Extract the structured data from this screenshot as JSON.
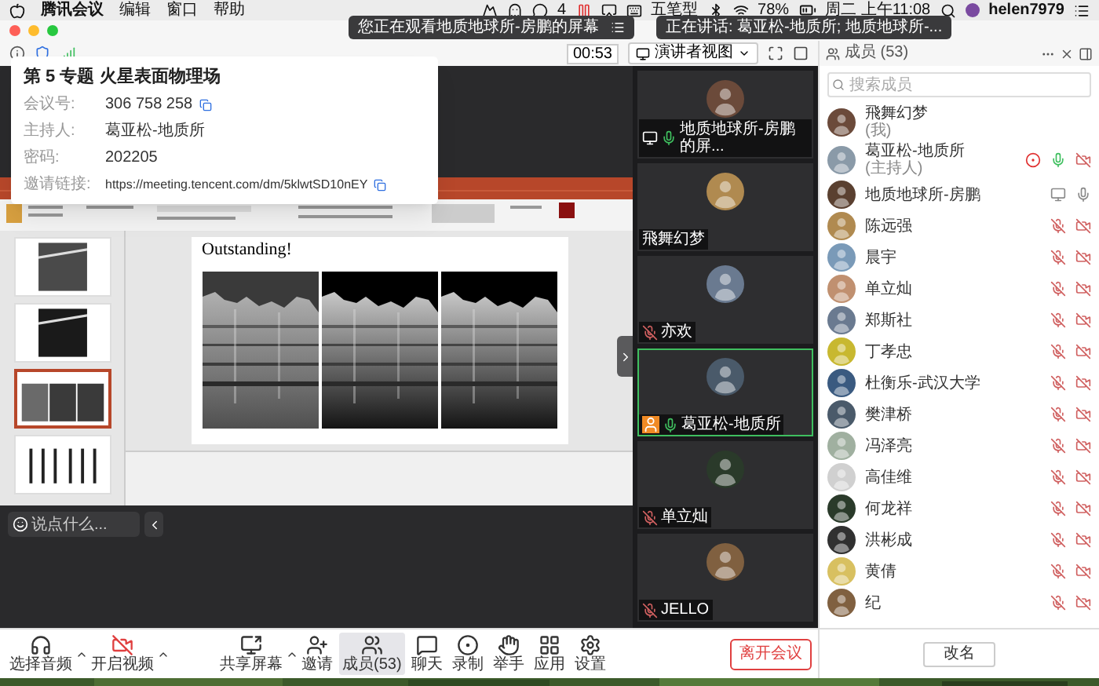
{
  "menu_bar": {
    "app_menus": [
      "腾讯会议",
      "编辑",
      "窗口",
      "帮助"
    ],
    "chat_badge": "4",
    "input_method": "五笔型",
    "battery": "78%",
    "clock": "周二 上午11:08",
    "user": "helen7979"
  },
  "window": {
    "notice": "您正在观看地质地球所-房鹏的屏幕",
    "speaking": "正在讲话: 葛亚松-地质所; 地质地球所-...",
    "timer": "00:53",
    "view_button": "演讲者视图"
  },
  "meeting_info": {
    "title": "第 5 专题 火星表面物理场",
    "rows": [
      {
        "label": "会议号:",
        "value": "306 758 258",
        "copyable": true
      },
      {
        "label": "主持人:",
        "value": "葛亚松-地质所",
        "copyable": false
      },
      {
        "label": "密码:",
        "value": "202205",
        "copyable": false
      },
      {
        "label": "邀请链接:",
        "value": "https://meeting.tencent.com/dm/5klwtSD10nEY",
        "copyable": true
      }
    ]
  },
  "presentation": {
    "slide_title": "Outstanding!",
    "thumbnails": [
      {
        "selected": false
      },
      {
        "selected": false
      },
      {
        "selected": true
      },
      {
        "selected": false
      }
    ]
  },
  "chat_input": {
    "placeholder": "说点什么..."
  },
  "videos": [
    {
      "name": "地质地球所-房鹏的屏...",
      "talking": true,
      "muted": false,
      "sharing": true,
      "host": false,
      "speaking": false
    },
    {
      "name": "飛舞幻梦",
      "talking": false,
      "muted": false,
      "sharing": false,
      "host": false,
      "speaking": false
    },
    {
      "name": "亦欢",
      "talking": false,
      "muted": true,
      "sharing": false,
      "host": false,
      "speaking": false
    },
    {
      "name": "葛亚松-地质所",
      "talking": true,
      "muted": false,
      "sharing": false,
      "host": true,
      "speaking": true
    },
    {
      "name": "单立灿",
      "talking": false,
      "muted": true,
      "sharing": false,
      "host": false,
      "speaking": false
    },
    {
      "name": "JELLO",
      "talking": false,
      "muted": true,
      "sharing": false,
      "host": false,
      "speaking": false
    }
  ],
  "members_panel": {
    "title": "成员 (53)",
    "search": {
      "placeholder": "搜索成员"
    },
    "members": [
      {
        "name": "飛舞幻梦",
        "role": "(我)",
        "recording": false,
        "sharing": false,
        "talking": false,
        "mic_on": false,
        "muted": false,
        "camera_off": false
      },
      {
        "name": "葛亚松-地质所",
        "role": "(主持人)",
        "recording": true,
        "sharing": false,
        "talking": true,
        "mic_on": false,
        "muted": false,
        "camera_off": true
      },
      {
        "name": "地质地球所-房鹏",
        "recording": false,
        "sharing": true,
        "talking": false,
        "mic_on": true,
        "muted": false,
        "camera_off": false
      },
      {
        "name": "陈远强",
        "recording": false,
        "sharing": false,
        "talking": false,
        "mic_on": false,
        "muted": true,
        "camera_off": true
      },
      {
        "name": "晨宇",
        "recording": false,
        "sharing": false,
        "talking": false,
        "mic_on": false,
        "muted": true,
        "camera_off": true
      },
      {
        "name": "单立灿",
        "recording": false,
        "sharing": false,
        "talking": false,
        "mic_on": false,
        "muted": true,
        "camera_off": true
      },
      {
        "name": "郑斯社",
        "recording": false,
        "sharing": false,
        "talking": false,
        "mic_on": false,
        "muted": true,
        "camera_off": true
      },
      {
        "name": "丁孝忠",
        "recording": false,
        "sharing": false,
        "talking": false,
        "mic_on": false,
        "muted": true,
        "camera_off": true
      },
      {
        "name": "杜衡乐-武汉大学",
        "recording": false,
        "sharing": false,
        "talking": false,
        "mic_on": false,
        "muted": true,
        "camera_off": true
      },
      {
        "name": "樊津桥",
        "recording": false,
        "sharing": false,
        "talking": false,
        "mic_on": false,
        "muted": true,
        "camera_off": true
      },
      {
        "name": "冯泽亮",
        "recording": false,
        "sharing": false,
        "talking": false,
        "mic_on": false,
        "muted": true,
        "camera_off": true
      },
      {
        "name": "高佳维",
        "recording": false,
        "sharing": false,
        "talking": false,
        "mic_on": false,
        "muted": true,
        "camera_off": true
      },
      {
        "name": "何龙祥",
        "recording": false,
        "sharing": false,
        "talking": false,
        "mic_on": false,
        "muted": true,
        "camera_off": true
      },
      {
        "name": "洪彬成",
        "recording": false,
        "sharing": false,
        "talking": false,
        "mic_on": false,
        "muted": true,
        "camera_off": true
      },
      {
        "name": "黄倩",
        "recording": false,
        "sharing": false,
        "talking": false,
        "mic_on": false,
        "muted": true,
        "camera_off": true
      },
      {
        "name": "纪",
        "recording": false,
        "sharing": false,
        "talking": false,
        "mic_on": false,
        "muted": true,
        "camera_off": true
      }
    ],
    "rename_button": "改名"
  },
  "toolbar": {
    "items": [
      {
        "label": "选择音频",
        "kind": "audio",
        "menu": true,
        "selected": false
      },
      {
        "label": "开启视频",
        "kind": "video",
        "menu": true,
        "selected": false
      },
      {
        "label": "共享屏幕",
        "kind": "share",
        "menu": true,
        "selected": false
      },
      {
        "label": "邀请",
        "kind": "invite",
        "menu": false,
        "selected": false
      },
      {
        "label": "成员(53)",
        "kind": "members",
        "menu": false,
        "selected": true
      },
      {
        "label": "聊天",
        "kind": "chat",
        "menu": false,
        "selected": false
      },
      {
        "label": "录制",
        "kind": "record",
        "menu": false,
        "selected": false
      },
      {
        "label": "举手",
        "kind": "hand",
        "menu": false,
        "selected": false
      },
      {
        "label": "应用",
        "kind": "apps",
        "menu": false,
        "selected": false
      },
      {
        "label": "设置",
        "kind": "settings",
        "menu": false,
        "selected": false
      }
    ],
    "leave_button": "离开会议"
  }
}
